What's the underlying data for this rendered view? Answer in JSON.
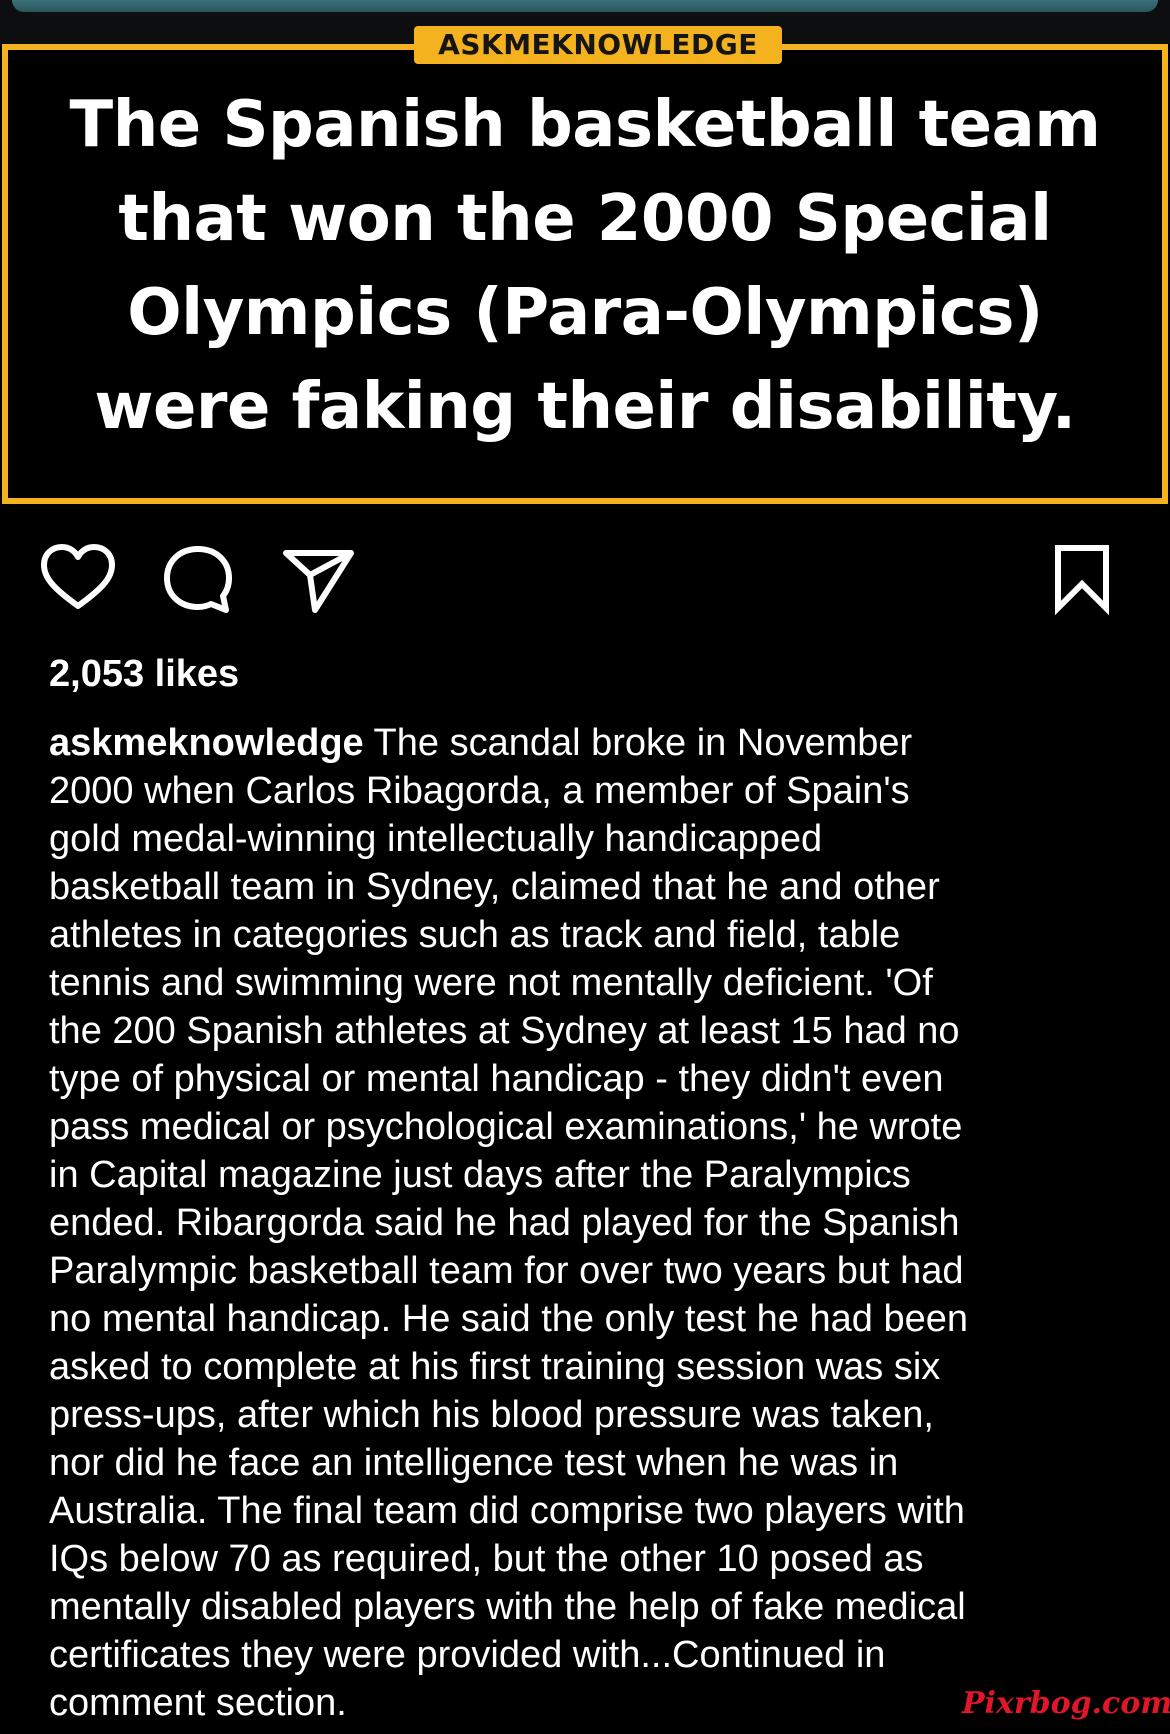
{
  "post": {
    "brand_badge": "ASKMEKNOWLEDGE",
    "quote_lines": [
      "The Spanish basketball team",
      "that won the 2000 Special",
      "Olympics (Para-Olympics)",
      "were faking their disability."
    ]
  },
  "actions": {
    "like_icon": "heart-outline-icon",
    "comment_icon": "speech-bubble-icon",
    "share_icon": "paper-plane-icon",
    "save_icon": "bookmark-icon"
  },
  "likes": {
    "label": "2,053 likes"
  },
  "caption": {
    "username": "askmeknowledge",
    "first_line_rest": " The scandal broke in November",
    "lines": [
      "2000 when Carlos Ribagorda, a member of Spain's",
      "gold medal-winning intellectually handicapped",
      "basketball team in Sydney, claimed that he and other",
      "athletes in categories such as track and field, table",
      "tennis and swimming were not mentally deficient. 'Of",
      "the 200 Spanish athletes at Sydney at least 15 had no",
      "type of physical or mental handicap - they didn't even",
      "pass medical or psychological examinations,' he wrote",
      "in Capital magazine just days after the Paralympics",
      "ended. Ribargorda said he had played for the Spanish",
      "Paralympic basketball team for over two years but had",
      "no mental handicap. He said the only test he had been",
      "asked to complete at his first training session was six",
      "press-ups, after which his blood pressure was taken,",
      "nor did he face an intelligence test when he was in",
      "Australia. The final team did comprise two players with",
      "IQs below 70 as required, but the other 10 posed as",
      "mentally disabled players with the help of fake medical",
      "certificates they were provided with...Continued in",
      "comment section."
    ]
  },
  "watermark": {
    "text": "Pixrbog.com"
  },
  "colors": {
    "background": "#000000",
    "frame_accent": "#f4b21e",
    "text": "#ffffff",
    "watermark": "#e0162b"
  }
}
